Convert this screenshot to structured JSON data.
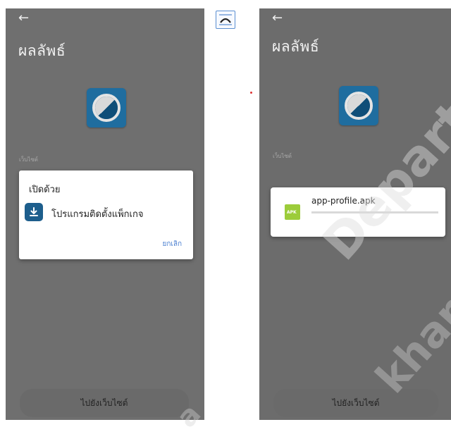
{
  "left_screen": {
    "back_icon": "arrow-left-icon",
    "title": "ผลลัพธ์",
    "small_label": "เว็บไซต์",
    "dialog": {
      "title": "เปิดด้วย",
      "option_label": "โปรแกรมติดตั้งแพ็กเกจ",
      "option_icon": "download-icon",
      "cancel_label": "ยกเลิก"
    },
    "bottom_button": "ไปยังเว็บไซต์"
  },
  "right_screen": {
    "back_icon": "arrow-left-icon",
    "title": "ผลลัพธ์",
    "small_label": "เว็บไซต์",
    "download": {
      "file_name": "app-profile.apk",
      "icon_text": "APK",
      "progress_fraction": 0.0
    },
    "bottom_button": "ไปยังเว็บไซต์"
  },
  "overlay": {
    "watermark_1": "Departm",
    "watermark_2": "kham",
    "watermark_3": "a"
  },
  "colors": {
    "dim_background": "#6f6f6f",
    "app_icon": "#1f6d9f",
    "apk_icon": "#9ccc3a",
    "accent_link": "#4a7fd0"
  }
}
